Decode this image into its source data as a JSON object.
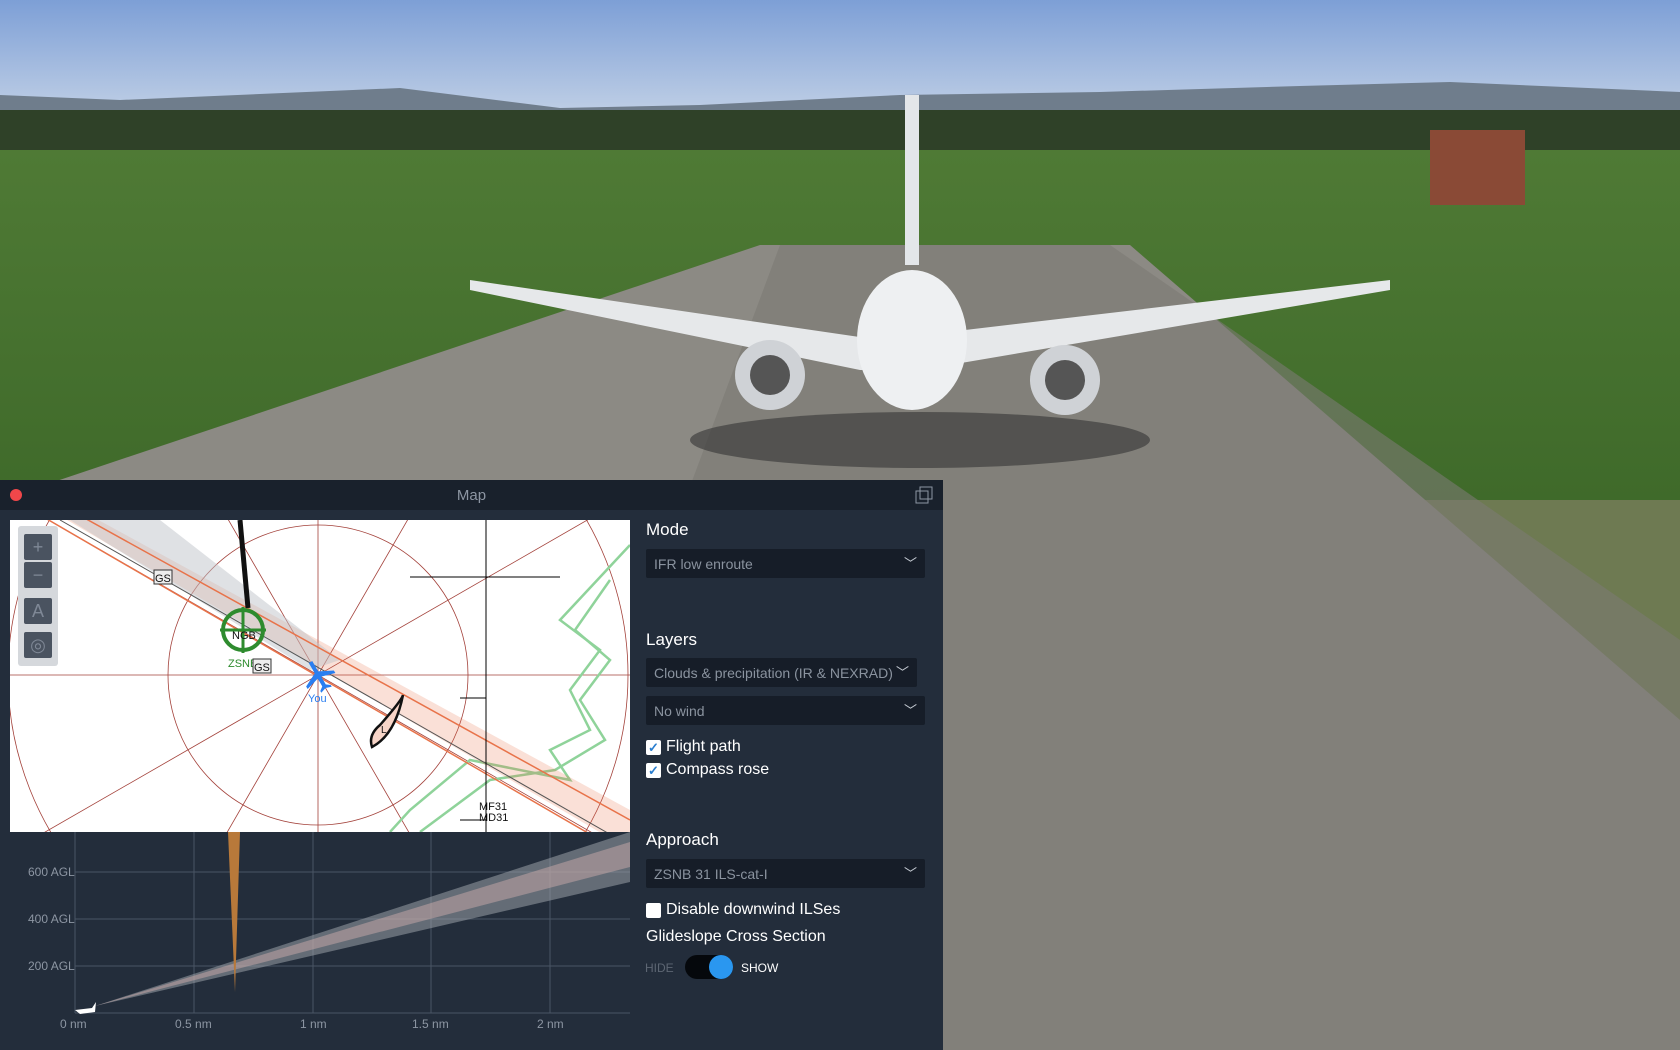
{
  "window": {
    "title": "Map",
    "close_icon": "close-icon",
    "popout_icon": "popout-icon"
  },
  "map": {
    "controls": {
      "zoom_in": "+",
      "zoom_out": "−",
      "north_up": "A",
      "center": "target-icon"
    },
    "labels": {
      "airport": "ZSNB",
      "navaid": "NGB",
      "you": "You",
      "gs1": "GS",
      "gs2": "GS",
      "fix1": "MF31",
      "fix2": "MD31",
      "loc": "L"
    },
    "colors": {
      "flight_path": "#e8734a",
      "airport": "#2e8b2e",
      "aircraft": "#2a7ef0",
      "terrain": "#8fd39a"
    }
  },
  "profile": {
    "y_labels": [
      "600 AGL",
      "400 AGL",
      "200 AGL"
    ],
    "x_labels": [
      "0 nm",
      "0.5 nm",
      "1 nm",
      "1.5 nm",
      "2 nm"
    ]
  },
  "panel": {
    "mode_label": "Mode",
    "mode_value": "IFR low enroute",
    "layers_label": "Layers",
    "layers_value": "Clouds & precipitation (IR & NEXRAD)",
    "wind_value": "No wind",
    "flight_path": {
      "label": "Flight path",
      "checked": true
    },
    "compass_rose": {
      "label": "Compass rose",
      "checked": true
    },
    "approach_label": "Approach",
    "approach_value": "ZSNB 31 ILS-cat-I",
    "disable_downwind": {
      "label": "Disable downwind ILSes",
      "checked": false
    },
    "glideslope_label": "Glideslope Cross Section",
    "toggle": {
      "off": "HIDE",
      "on": "SHOW",
      "state": "SHOW"
    }
  }
}
